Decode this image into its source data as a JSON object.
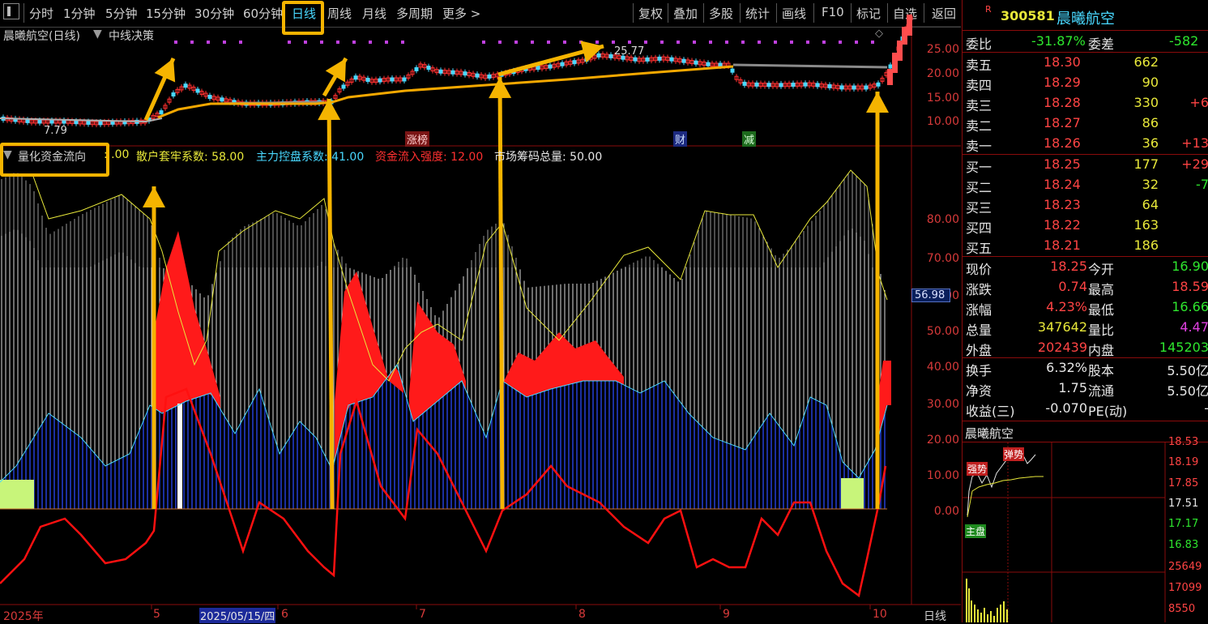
{
  "toolbar": {
    "left_tabs": [
      "分时",
      "1分钟",
      "5分钟",
      "15分钟",
      "30分钟",
      "60分钟",
      "日线",
      "周线",
      "月线",
      "多周期",
      "更多 >"
    ],
    "active_tab": "日线",
    "right_tabs": [
      "复权",
      "叠加",
      "多股",
      "统计",
      "画线",
      "F10",
      "标记",
      "自选",
      "返回"
    ]
  },
  "kline_panel": {
    "title": "晨曦航空(日线)",
    "indicator": "中线决策",
    "price_axis": [
      "25.00",
      "20.00",
      "15.00",
      "10.00"
    ],
    "high_label": "25.77",
    "low_label": "7.79",
    "event_tags": [
      "涨榜",
      "财",
      "减"
    ]
  },
  "indicator_panel": {
    "name": "量化资金流向",
    "params": [
      {
        "label": "散户套牢系数",
        "value": "58.00",
        "color": "#e8e83a",
        "partial_prefix": ": .00"
      },
      {
        "label": "主力控盘系数",
        "value": "41.00",
        "color": "#49d8ff"
      },
      {
        "label": "资金流入强度",
        "value": "12.00",
        "color": "#ff3030"
      },
      {
        "label": "市场筹码总量",
        "value": "50.00",
        "color": "#e6e6e6"
      }
    ],
    "axis": [
      "80.00",
      "70.00",
      "60.00",
      "50.00",
      "40.00",
      "30.00",
      "20.00",
      "10.00",
      "0.00"
    ],
    "current_value": "56.98"
  },
  "date_axis": {
    "labels": [
      "2025年",
      "5",
      "2025/05/15/四",
      "6",
      "7",
      "8",
      "9",
      "10"
    ],
    "period": "日线"
  },
  "quote": {
    "code": "300581",
    "name": "晨曦航空",
    "marker": "R",
    "weibi_label": "委比",
    "weibi": "-31.87%",
    "weicha_label": "委差",
    "weicha": "-582",
    "asks": [
      {
        "label": "卖五",
        "price": "18.30",
        "vol": "662",
        "chg": ""
      },
      {
        "label": "卖四",
        "price": "18.29",
        "vol": "90",
        "chg": ""
      },
      {
        "label": "卖三",
        "price": "18.28",
        "vol": "330",
        "chg": "+6"
      },
      {
        "label": "卖二",
        "price": "18.27",
        "vol": "86",
        "chg": ""
      },
      {
        "label": "卖一",
        "price": "18.26",
        "vol": "36",
        "chg": "+13"
      }
    ],
    "bids": [
      {
        "label": "买一",
        "price": "18.25",
        "vol": "177",
        "chg": "+29"
      },
      {
        "label": "买二",
        "price": "18.24",
        "vol": "32",
        "chg": "-7"
      },
      {
        "label": "买三",
        "price": "18.23",
        "vol": "64",
        "chg": ""
      },
      {
        "label": "买四",
        "price": "18.22",
        "vol": "163",
        "chg": ""
      },
      {
        "label": "买五",
        "price": "18.21",
        "vol": "186",
        "chg": ""
      }
    ],
    "stats": [
      {
        "l1": "现价",
        "v1": "18.25",
        "c1": "#ff4444",
        "l2": "今开",
        "v2": "16.90",
        "c2": "#2ee62e"
      },
      {
        "l1": "涨跌",
        "v1": "0.74",
        "c1": "#ff4444",
        "l2": "最高",
        "v2": "18.59",
        "c2": "#ff4444"
      },
      {
        "l1": "涨幅",
        "v1": "4.23%",
        "c1": "#ff4444",
        "l2": "最低",
        "v2": "16.66",
        "c2": "#2ee62e"
      },
      {
        "l1": "总量",
        "v1": "347642",
        "c1": "#e8e83a",
        "l2": "量比",
        "v2": "4.47",
        "c2": "#e040e0"
      },
      {
        "l1": "外盘",
        "v1": "202439",
        "c1": "#ff4444",
        "l2": "内盘",
        "v2": "145203",
        "c2": "#2ee62e"
      }
    ],
    "stats2": [
      {
        "l1": "换手",
        "v1": "6.32%",
        "l2": "股本",
        "v2": "5.50亿"
      },
      {
        "l1": "净资",
        "v1": "1.75",
        "l2": "流通",
        "v2": "5.50亿"
      },
      {
        "l1": "收益(三)",
        "v1": "-0.070",
        "l2": "PE(动)",
        "v2": "-"
      }
    ]
  },
  "mini_chart": {
    "title": "晨曦航空",
    "price_axis": [
      "18.53",
      "18.19",
      "17.85",
      "17.51",
      "17.17",
      "16.83"
    ],
    "vol_axis": [
      "25649",
      "17099",
      "8550"
    ],
    "tags": [
      "强势",
      "弹势",
      "主盘"
    ]
  }
}
